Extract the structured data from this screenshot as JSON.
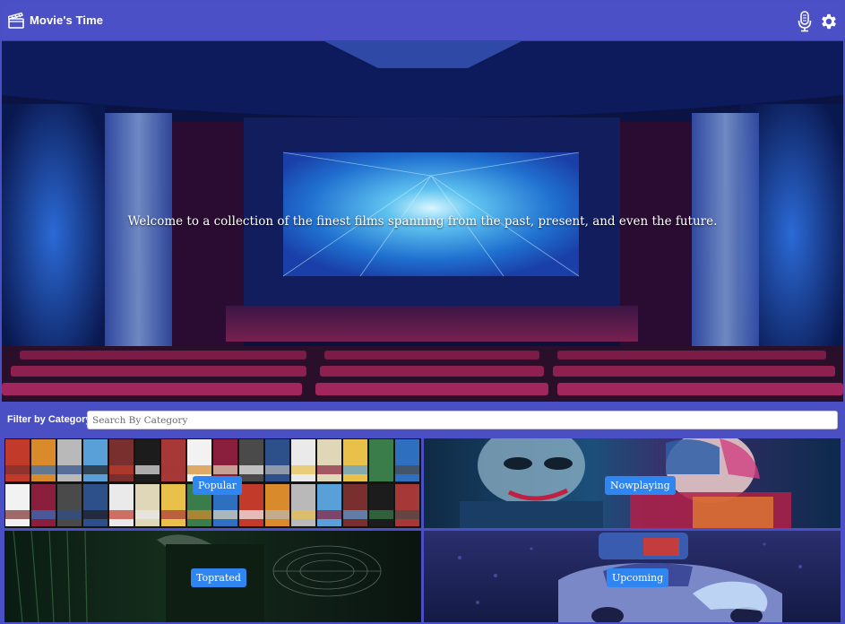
{
  "app": {
    "title": "Movie's Time"
  },
  "header": {
    "mic_icon": "microphone-icon",
    "settings_icon": "gear-icon",
    "logo_icon": "clapperboard-icon"
  },
  "hero": {
    "tagline": "Welcome to a collection of the finest films spanning from the past, present, and even the future."
  },
  "filter": {
    "label": "Filter by Category",
    "placeholder": "Search By Category",
    "value": ""
  },
  "categories": [
    {
      "label": "Popular"
    },
    {
      "label": "Nowplaying"
    },
    {
      "label": "Toprated"
    },
    {
      "label": "Upcoming"
    }
  ],
  "colors": {
    "header": "#4c50c7",
    "button": "#2f86f0",
    "accent": "#4a4fc4"
  }
}
